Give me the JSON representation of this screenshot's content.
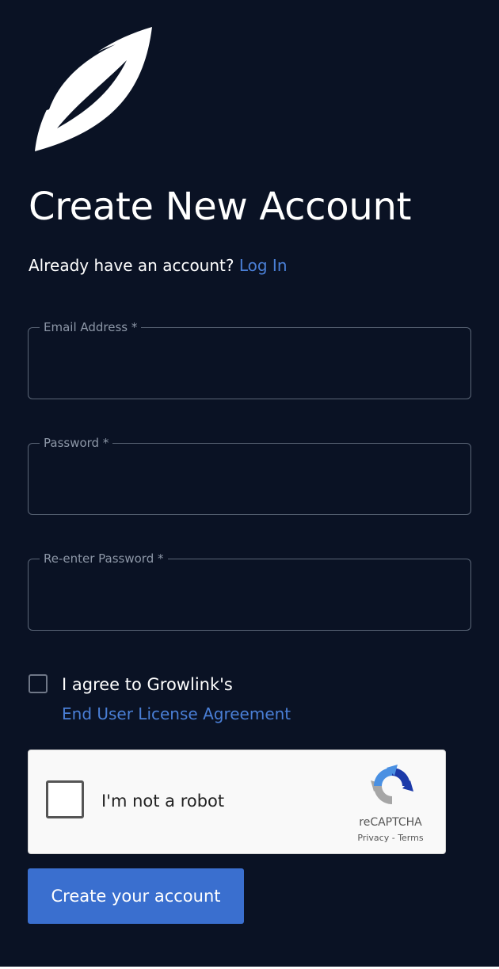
{
  "colors": {
    "background": "#0a1224",
    "link": "#4a7fd6",
    "primary_button": "#3a6fcf",
    "field_border": "#5b6677"
  },
  "logo": {
    "icon": "leaf-logo"
  },
  "page": {
    "title": "Create New Account",
    "already_text": "Already have an account?",
    "login_link": "Log In"
  },
  "form": {
    "email": {
      "label": "Email Address *",
      "value": ""
    },
    "password": {
      "label": "Password *",
      "value": ""
    },
    "reenter_password": {
      "label": "Re-enter Password *",
      "value": ""
    },
    "agree": {
      "checked": false,
      "text": "I agree to Growlink's",
      "link": "End User License Agreement"
    }
  },
  "captcha": {
    "checked": false,
    "label": "I'm not a robot",
    "brand": "reCAPTCHA",
    "privacy": "Privacy",
    "separator": " - ",
    "terms": "Terms",
    "icon": "recaptcha-icon"
  },
  "submit": {
    "label": "Create your account"
  }
}
